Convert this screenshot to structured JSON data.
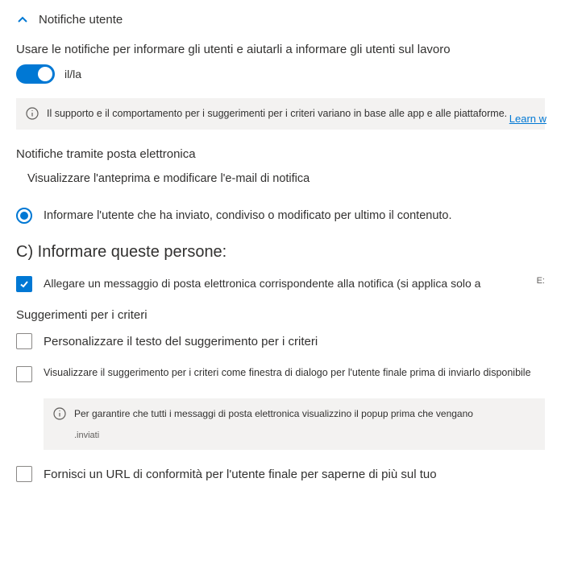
{
  "section": {
    "title": "Notifiche utente"
  },
  "intro": {
    "subtitle": "Usare le notifiche per informare gli utenti e aiutarli a informare gli utenti sul lavoro",
    "toggle_label": "il/la"
  },
  "banner1": {
    "text": "Il supporto e il comportamento per i suggerimenti per i criteri variano in base alle app e alle piattaforme.",
    "learn": "Learn w"
  },
  "email_section": {
    "title": "Notifiche tramite posta elettronica",
    "preview_text": "Visualizzare l'anteprima e modificare l'e-mail di notifica"
  },
  "radio1": {
    "label": "Informare l'utente che ha inviato, condiviso o modificato per ultimo il contenuto."
  },
  "section_c": {
    "title": "C) Informare queste persone:"
  },
  "checkbox_attach": {
    "label": "Allegare un messaggio di posta elettronica corrispondente alla notifica (si applica solo a",
    "suffix": "E:"
  },
  "suggestions": {
    "title": "Suggerimenti per i criteri"
  },
  "checkbox_customize": {
    "label": "Personalizzare il testo del suggerimento per i criteri"
  },
  "checkbox_dialog": {
    "label": "Visualizzare il suggerimento per i criteri come finestra di dialogo per l'utente finale prima di inviarlo disponibile"
  },
  "banner2": {
    "text": "Per garantire che tutti i messaggi di posta elettronica visualizzino il popup prima che vengano",
    "sent": ".inviati"
  },
  "checkbox_url": {
    "label": "Fornisci un URL di conformità per l'utente finale per saperne di più sul tuo"
  }
}
